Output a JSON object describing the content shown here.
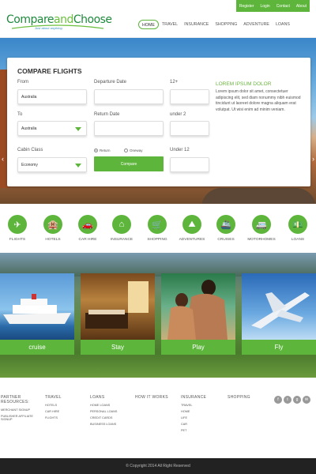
{
  "topbar": {
    "links": [
      "Register",
      "Login",
      "Contact",
      "About"
    ]
  },
  "logo": {
    "part1": "Compare",
    "part2": "and",
    "part3": "Choose",
    "tagline": "Just about anything"
  },
  "nav": [
    "HOME",
    "TRAVEL",
    "INSURANCE",
    "SHOPPING",
    "ADVENTURE",
    "LOANS"
  ],
  "form": {
    "title": "COMPARE FLIGHTS",
    "from_label": "From",
    "from_value": "Australia",
    "to_label": "To",
    "to_value": "Australia",
    "departure_label": "Departure Date",
    "return_label": "Return Date",
    "adult_label": "12+",
    "child_label": "under 2",
    "infant_label": "Under 12",
    "cabin_label": "Cabin Class",
    "cabin_value": "Economy",
    "radio_return": "Return",
    "radio_oneway": "Oneway",
    "compare_button": "Compare"
  },
  "promo": {
    "heading": "LOREM IPSUM DOLOR",
    "text": "Lorem ipsum dolor sit amet, consectetuer adipiscing elit, sed diam nonummy nibh euismod tincidunt ut laoreet dolore magna aliquam erat volutpat. Ut wisi enim ad minim veniam."
  },
  "categories": [
    {
      "label": "FLIGHTS",
      "icon": "plane-icon"
    },
    {
      "label": "HOTELS",
      "icon": "hotel-icon"
    },
    {
      "label": "CAR HIRE",
      "icon": "car-icon"
    },
    {
      "label": "INSURANCE",
      "icon": "house-icon"
    },
    {
      "label": "SHOPPING",
      "icon": "shopping-cart-icon"
    },
    {
      "label": "ADVENTURES",
      "icon": "mountain-icon"
    },
    {
      "label": "CRUISES",
      "icon": "ship-icon"
    },
    {
      "label": "MOTORHOMES",
      "icon": "motorhome-icon"
    },
    {
      "label": "LOANS",
      "icon": "money-icon"
    }
  ],
  "cards": [
    "cruise",
    "Stay",
    "Play",
    "Fly"
  ],
  "footer": {
    "partner_heading_1": "PARTNER",
    "partner_heading_2": "RESOURCES:",
    "partner_items": [
      "MERCHANT SIGNUP",
      "PUBLISHER AFFILIATE SIGNUP"
    ],
    "travel_heading": "TRAVEL",
    "travel_items": [
      "HOTELS",
      "CAR HIRE",
      "FLIGHTS"
    ],
    "loans_heading": "LOANS",
    "loans_items": [
      "HOME LOANS",
      "PERSONAL LOANS",
      "CREDIT CARDS",
      "BUSINESS LOANS"
    ],
    "how_heading": "HOW IT WORKS",
    "insurance_heading": "INSURANCE",
    "insurance_items": [
      "TRAVEL",
      "HOME",
      "LIFE",
      "CAR",
      "PET"
    ],
    "shopping_heading": "SHOPPING",
    "social": [
      "facebook-icon",
      "twitter-icon",
      "googleplus-icon",
      "email-icon"
    ]
  },
  "copyright": "© Copyright 2014 All Right Reserved",
  "colors": {
    "accent": "#5db63b",
    "dark": "#222222"
  }
}
